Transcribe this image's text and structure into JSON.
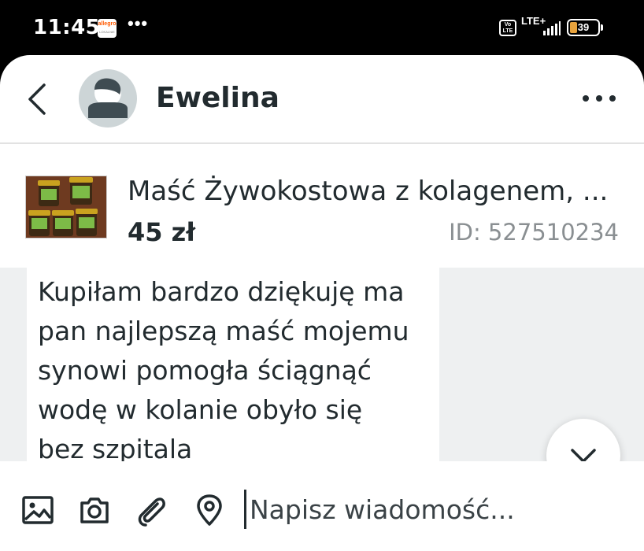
{
  "status_bar": {
    "time": "11:45",
    "app_badge_brand": "allegro",
    "app_badge_sub": "LOKALNIE",
    "more_dots": "•••",
    "volte_top": "Vo",
    "volte_bottom": "LTE",
    "network": "LTE+",
    "battery_level": "39"
  },
  "header": {
    "contact_name": "Ewelina"
  },
  "product": {
    "title": "Maść Żywokostowa z kolagenem, ...",
    "price": "45 zł",
    "id_label": "ID: 527510234"
  },
  "conversation": {
    "message_text": "Kupiłam bardzo dziękuję ma\npan  najlepszą maść mojemu\nsynowi pomogła ściągnąć\nwodę w kolanie obyło się\nbez szpitala"
  },
  "composer": {
    "placeholder": "Napisz wiadomość..."
  },
  "colors": {
    "text_dark": "#222b2f",
    "muted_gray": "#8a8f92",
    "bubble_bg": "#eef0f1",
    "battery_accent": "#e8a33d"
  }
}
